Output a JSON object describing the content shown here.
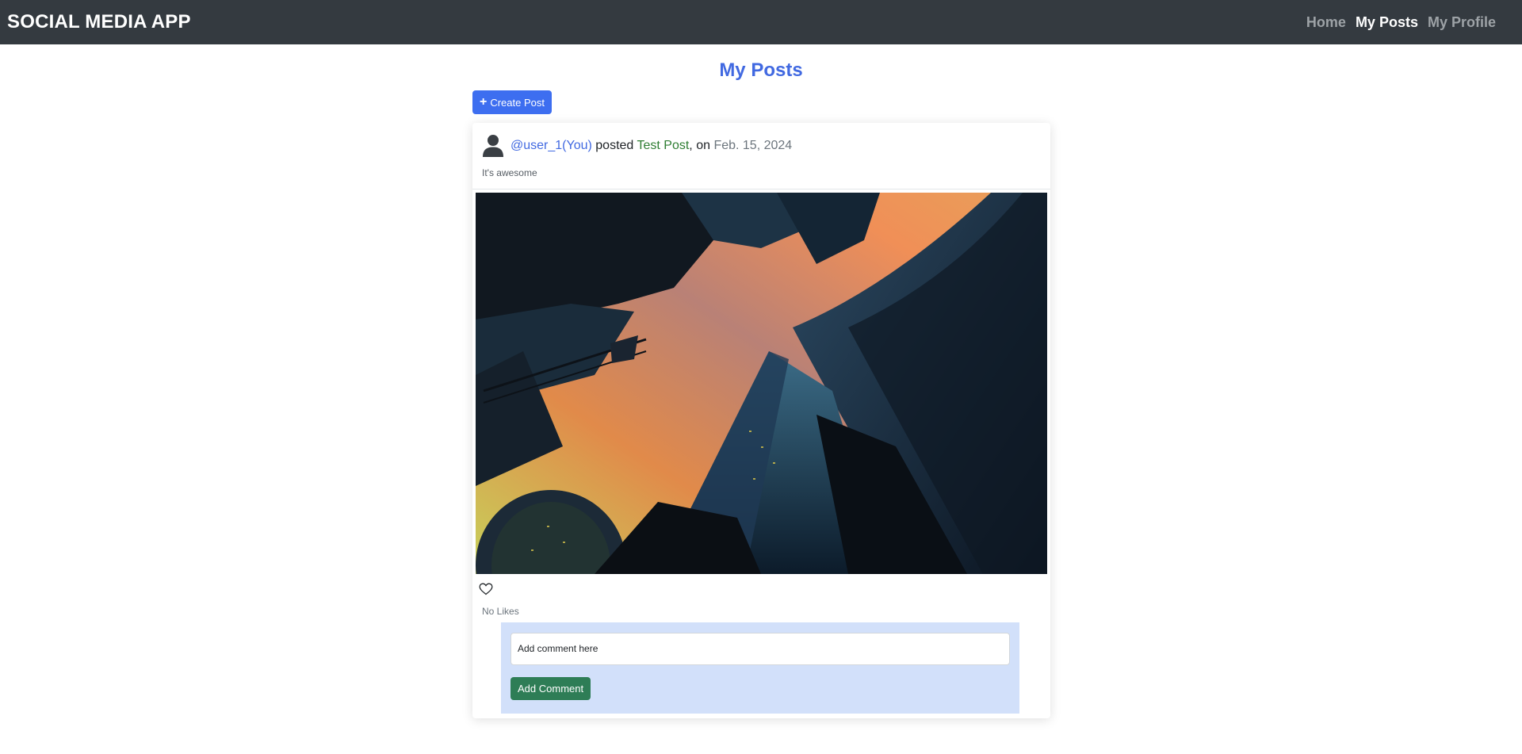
{
  "navbar": {
    "brand": "SOCIAL MEDIA APP",
    "links": [
      {
        "label": "Home",
        "active": false
      },
      {
        "label": "My Posts",
        "active": true
      },
      {
        "label": "My Profile",
        "active": false
      }
    ]
  },
  "page": {
    "title": "My Posts",
    "create_button_label": "Create Post"
  },
  "post": {
    "username": "@user_1(You)",
    "posted_word": "posted",
    "title": "Test Post",
    "on_word": ", on",
    "date": "Feb. 15, 2024",
    "description": "It's awesome",
    "likes_text": "No Likes",
    "image_icon": "skyscrapers-photo",
    "like_icon": "heart-outline-icon"
  },
  "comment": {
    "placeholder": "Add comment here",
    "button_label": "Add Comment"
  },
  "colors": {
    "navbar_bg": "#343a40",
    "title_blue": "#4169e1",
    "primary_button": "#3d6ef0",
    "success_button": "#2e7d56",
    "comment_panel": "#d2e0fa",
    "post_title_green": "#2e7d32"
  }
}
